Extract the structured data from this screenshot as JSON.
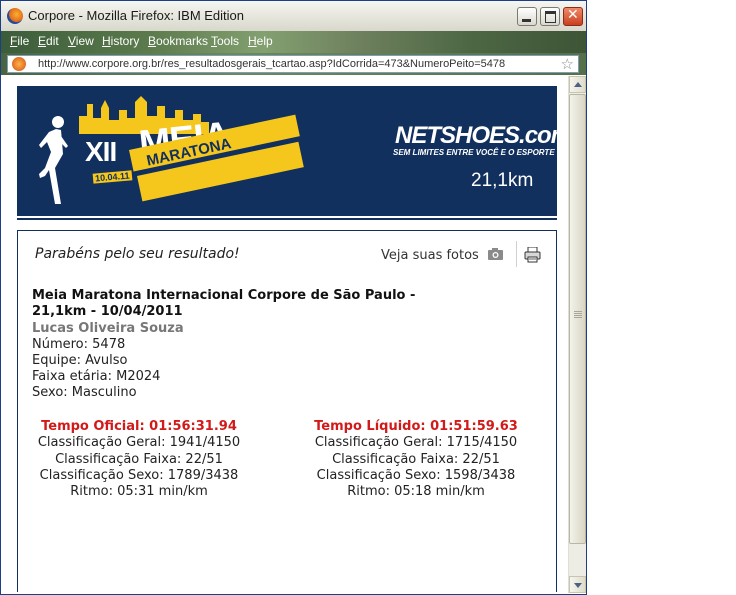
{
  "window": {
    "title": "Corpore - Mozilla Firefox: IBM Edition",
    "menu": [
      "File",
      "Edit",
      "View",
      "History",
      "Bookmarks",
      "Tools",
      "Help"
    ],
    "url": "http://www.corpore.org.br/res_resultadosgerais_tcartao.asp?IdCorrida=473&NumeroPeito=5478"
  },
  "banner": {
    "edition": "XII",
    "name_big": "MEIA",
    "name_sub": "MARATONA",
    "date": "10.04.11",
    "sponsor": "NETSHOES.com.br",
    "sponsor_tagline": "SEM LIMITES ENTRE VOCÊ E O ESPORTE",
    "distance": "21,1km",
    "colors": {
      "background": "#12305e",
      "ribbon": "#f5c61c"
    }
  },
  "result": {
    "congrats": "Parabéns pelo seu resultado!",
    "photos_link": "Veja suas fotos",
    "event_title": "Meia Maratona Internacional Corpore de São Paulo - 21,1km - 10/04/2011",
    "athlete_name": "Lucas Oliveira Souza",
    "numero": "Número: 5478",
    "equipe": "Equipe: Avulso",
    "faixa": "Faixa etária: M2024",
    "sexo": "Sexo: Masculino",
    "oficial": {
      "head": "Tempo Oficial: 01:56:31.94",
      "geral": "Classificação Geral: 1941/4150",
      "faixa": "Classificação Faixa: 22/51",
      "sexo": "Classificação Sexo: 1789/3438",
      "ritmo": "Ritmo: 05:31 min/km"
    },
    "liquido": {
      "head": "Tempo Líquido: 01:51:59.63",
      "geral": "Classificação Geral: 1715/4150",
      "faixa": "Classificação Faixa: 22/51",
      "sexo": "Classificação Sexo: 1598/3438",
      "ritmo": "Ritmo: 05:18 min/km"
    },
    "colors": {
      "time_heading": "#d21a1a",
      "athlete": "#777777"
    }
  }
}
